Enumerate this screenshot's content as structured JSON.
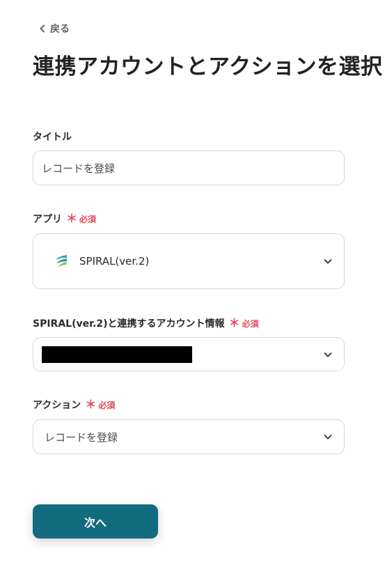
{
  "back": {
    "label": "戻る",
    "icon": "chevron-left-icon"
  },
  "page_title": "連携アカウントとアクションを選択",
  "fields": {
    "title": {
      "label": "タイトル",
      "value": "レコードを登録"
    },
    "app": {
      "label": "アプリ",
      "required_mark": "＊",
      "required_text": "必須",
      "value": "SPIRAL(ver.2)",
      "icon": "spiral-logo-icon"
    },
    "account": {
      "label": "SPIRAL(ver.2)と連携するアカウント情報",
      "required_mark": "＊",
      "required_text": "必須"
    },
    "action": {
      "label": "アクション",
      "required_mark": "＊",
      "required_text": "必須",
      "value": "レコードを登録"
    }
  },
  "next_button": {
    "label": "次へ"
  },
  "colors": {
    "primary": "#136b7f",
    "required": "#e24a5d",
    "border": "#d4d6d9"
  }
}
